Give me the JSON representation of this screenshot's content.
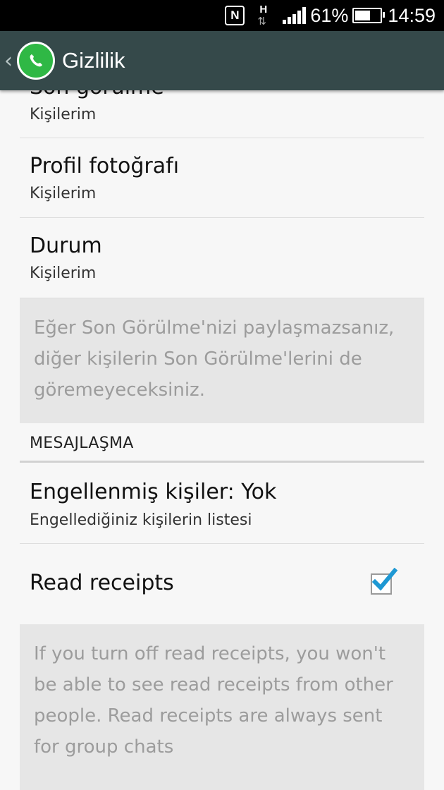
{
  "status_bar": {
    "battery": "61%",
    "time": "14:59",
    "battery_level": 0.61,
    "icons": [
      "nfc-icon",
      "network-h-icon",
      "signal-icon",
      "battery-icon"
    ]
  },
  "app_bar": {
    "title": "Gizlilik",
    "back_icon": "chevron-left-icon",
    "logo": "whatsapp-logo-icon",
    "colors": {
      "background": "#35494a",
      "logo": "#2fb845"
    }
  },
  "items": [
    {
      "title": "Son görülme",
      "summary": "Kişilerim"
    },
    {
      "title": "Profil fotoğrafı",
      "summary": "Kişilerim"
    },
    {
      "title": "Durum",
      "summary": "Kişilerim"
    }
  ],
  "info_last_seen": "Eğer Son Görülme'nizi paylaşmazsanız, diğer kişilerin Son Görülme'lerini de göremeyeceksiniz.",
  "section_messaging": "MESAJLAŞMA",
  "blocked": {
    "title": "Engellenmiş kişiler: Yok",
    "summary": "Engellediğiniz kişilerin listesi"
  },
  "read_receipts": {
    "title": "Read receipts",
    "checked": true,
    "check_color": "#1e98d3"
  },
  "info_read_receipts": "If you turn off read receipts, you won't be able to see read receipts from other people. Read receipts are always sent for group chats"
}
